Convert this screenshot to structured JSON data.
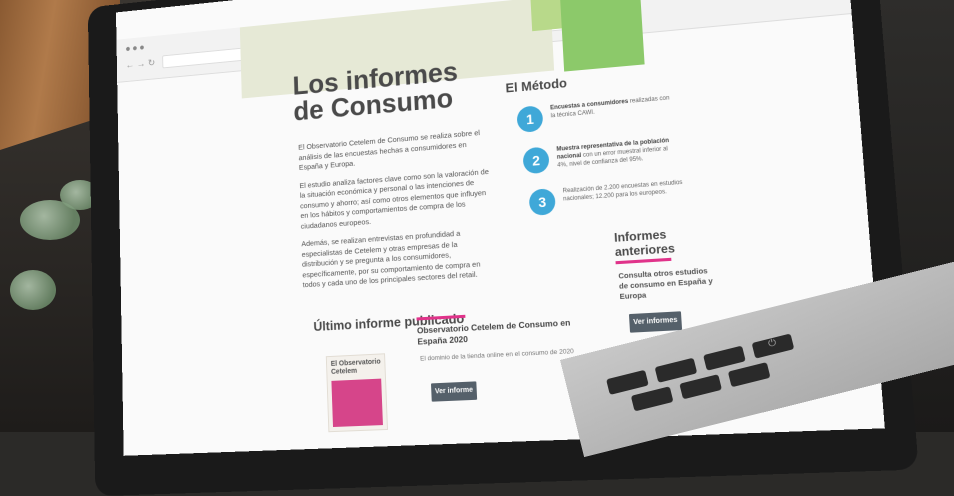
{
  "page": {
    "title_line1": "Los informes",
    "title_line2": "de Consumo",
    "intro": [
      "El Observatorio Cetelem de Consumo se realiza sobre el análisis de las encuestas hechas a consumidores en España y Europa.",
      "El estudio analiza factores clave como son la valoración de la situación económica y personal o las intenciones de consumo y ahorro; así como otros elementos que influyen en los hábitos y comportamientos de compra de los ciudadanos europeos.",
      "Además, se realizan entrevistas en profundidad a especialistas de Cetelem y otras empresas de la distribución y se pregunta a los consumidores, específicamente, por su comportamiento de compra en todos y cada uno de los principales sectores del retail."
    ],
    "metodo": {
      "title": "El Método",
      "steps": [
        {
          "num": "1",
          "bold": "Encuestas a consumidores",
          "text": " realizadas con la técnica CAWI."
        },
        {
          "num": "2",
          "bold": "Muestra representativa de la población nacional",
          "text": " con un error muestral inferior al 4%, nivel de confianza del 95%."
        },
        {
          "num": "3",
          "bold": "",
          "text": "Realización de 2.200 encuestas en estudios nacionales; 12.200 para los europeos."
        }
      ]
    },
    "previous": {
      "title_line1": "Informes",
      "title_line2": "anteriores",
      "desc": "Consulta otros estudios de consumo en España y Europa",
      "button": "Ver informes"
    },
    "latest": {
      "title": "Último informe publicado",
      "report_name": "Observatorio Cetelem de Consumo en España 2020",
      "report_sub": "El dominio de la tienda online en el consumo de 2020",
      "button": "Ver informe",
      "cover_text": "El Observatorio Cetelem"
    }
  },
  "colors": {
    "accent_pink": "#e0338a",
    "step_blue": "#3fa8d8",
    "green": "#8cc96a",
    "button": "#55606a"
  }
}
